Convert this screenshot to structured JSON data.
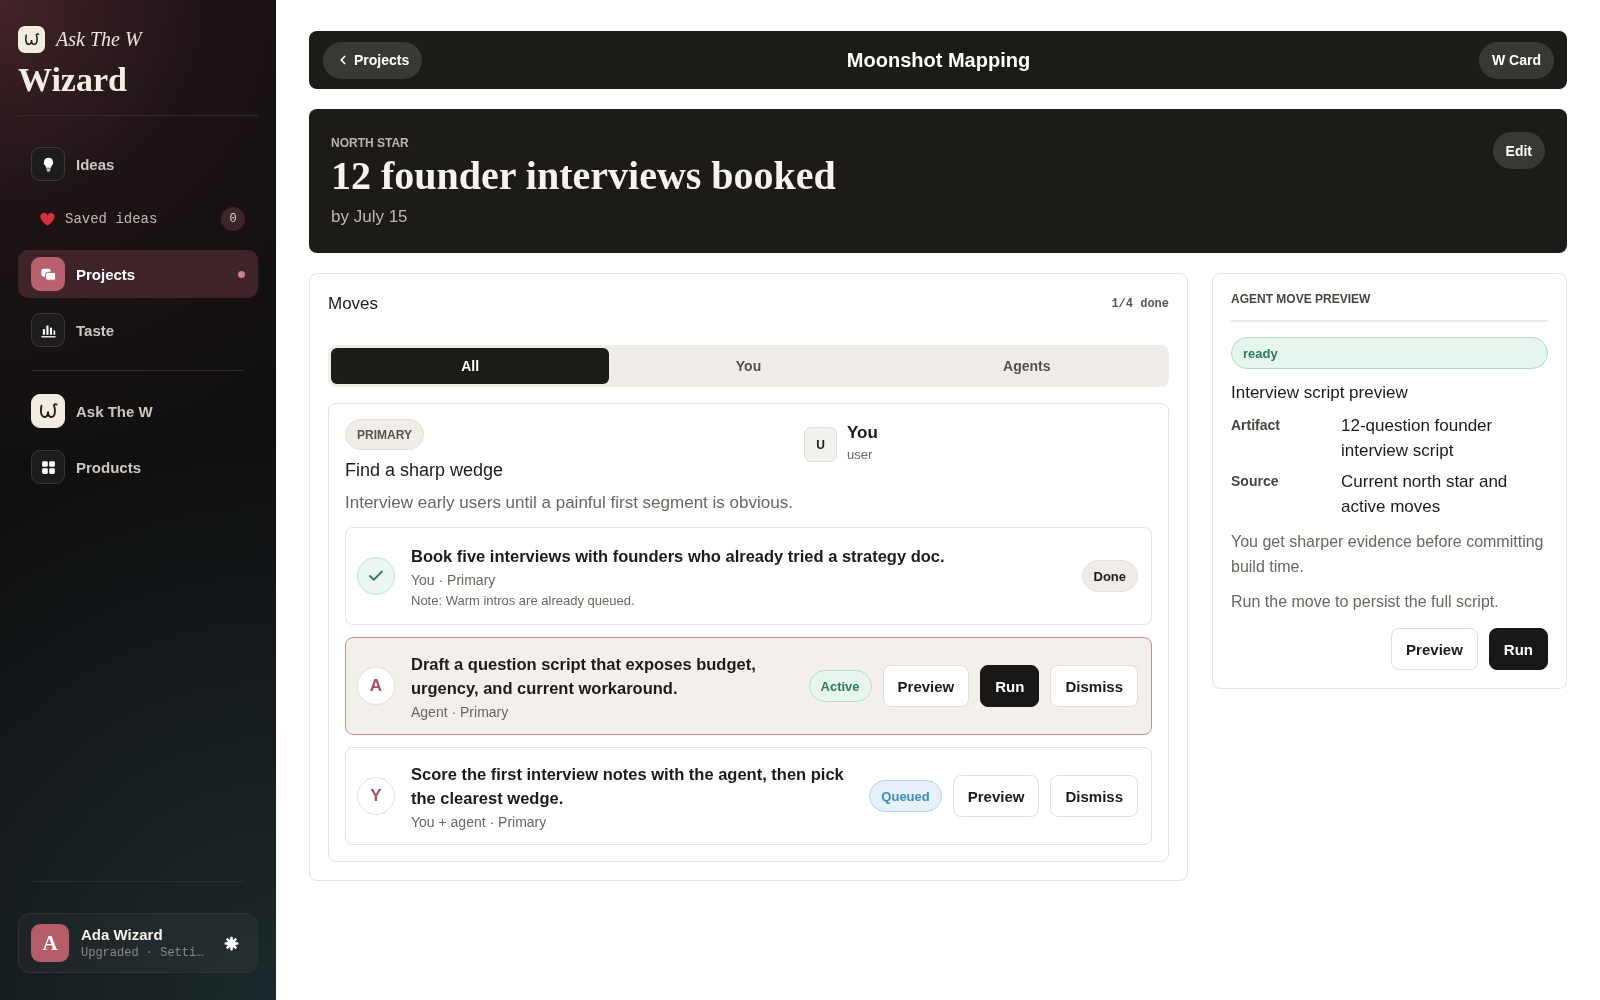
{
  "sidebar": {
    "brand": {
      "tagline": "Ask The W",
      "title": "Wizard"
    },
    "primary_nav": [
      {
        "kind": "nav",
        "label": "Ideas",
        "selected": false
      },
      {
        "kind": "sub",
        "label": "Saved ideas",
        "count": "0",
        "selected": false
      },
      {
        "kind": "nav",
        "label": "Projects",
        "selected": true
      },
      {
        "kind": "nav",
        "label": "Taste",
        "selected": false
      }
    ],
    "secondary_nav": [
      {
        "kind": "nav",
        "label": "Ask The W",
        "selected": false
      },
      {
        "kind": "nav",
        "label": "Products",
        "selected": false
      }
    ],
    "user": {
      "initial": "A",
      "name": "Ada Wizard",
      "detail": "Upgraded · Setti…"
    }
  },
  "header": {
    "back_button": "Projects",
    "title": "Moonshot Mapping",
    "card_button": "W Card"
  },
  "north_star": {
    "label": "NORTH STAR",
    "goal": "12 founder interviews booked",
    "deadline": "by July 15",
    "edit_button": "Edit"
  },
  "moves": {
    "title": "Moves",
    "progress": "1/4 done",
    "tabs": [
      {
        "label": "All",
        "selected": true
      },
      {
        "label": "You",
        "selected": false
      },
      {
        "label": "Agents",
        "selected": false
      }
    ],
    "group": {
      "tag": "PRIMARY",
      "title": "Find a sharp wedge",
      "description": "Interview early users until a painful first segment is obvious.",
      "owner": {
        "initial": "U",
        "name": "You",
        "role": "user"
      },
      "items": [
        {
          "kind": "done",
          "selected": false,
          "title": "Book five interviews with founders who already tried a strategy doc.",
          "meta": "You · Primary",
          "note": "Note: Warm intros are already queued.",
          "badge": "Done"
        },
        {
          "kind": "active",
          "selected": true,
          "initial": "A",
          "title": "Draft a question script that exposes budget, urgency, and current workaround.",
          "meta": "Agent · Primary",
          "badge": "Active",
          "actions": [
            {
              "kind": "secondary",
              "label": "Preview"
            },
            {
              "kind": "primary",
              "label": "Run"
            },
            {
              "kind": "secondary",
              "label": "Dismiss"
            }
          ]
        },
        {
          "kind": "queued",
          "selected": false,
          "initial": "Y",
          "title": "Score the first interview notes with the agent, then pick the clearest wedge.",
          "meta": "You + agent · Primary",
          "badge": "Queued",
          "actions": [
            {
              "kind": "secondary",
              "label": "Preview"
            },
            {
              "kind": "secondary",
              "label": "Dismiss"
            }
          ]
        }
      ]
    }
  },
  "preview": {
    "title": "AGENT MOVE PREVIEW",
    "status": "ready",
    "heading": "Interview script preview",
    "fields": [
      {
        "label": "Artifact",
        "value": "12-question founder interview script"
      },
      {
        "label": "Source",
        "value": "Current north star and active moves"
      }
    ],
    "paragraphs": [
      "You get sharper evidence before committing build time.",
      "Run the move to persist the full script."
    ],
    "actions": [
      {
        "kind": "secondary",
        "label": "Preview"
      },
      {
        "kind": "primary",
        "label": "Run"
      }
    ]
  }
}
